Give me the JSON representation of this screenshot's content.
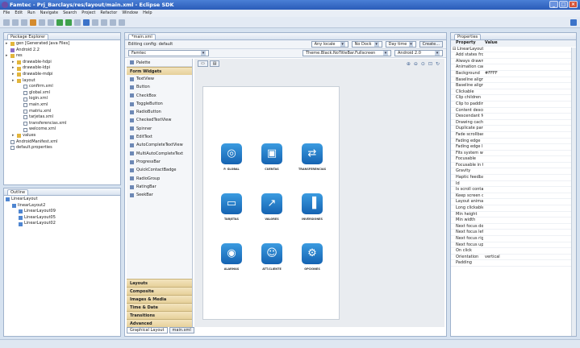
{
  "window": {
    "title": "Famtec - Prj_Barclays/res/layout/main.xml - Eclipse SDK"
  },
  "menu": [
    "File",
    "Edit",
    "Run",
    "Navigate",
    "Search",
    "Project",
    "Refactor",
    "Window",
    "Help"
  ],
  "package_explorer": {
    "tab_label": "Package Explorer",
    "items": [
      {
        "label": "gen [Generated Java Files]",
        "depth": 0,
        "icon": "folder-icon"
      },
      {
        "label": "Android 2.2",
        "depth": 0,
        "icon": "library-icon"
      },
      {
        "label": "res",
        "depth": 0,
        "icon": "folder-icon"
      },
      {
        "label": "drawable-hdpi",
        "depth": 1,
        "icon": "folder-icon"
      },
      {
        "label": "drawable-ldpi",
        "depth": 1,
        "icon": "folder-icon"
      },
      {
        "label": "drawable-mdpi",
        "depth": 1,
        "icon": "folder-icon"
      },
      {
        "label": "layout",
        "depth": 1,
        "icon": "folder-icon"
      },
      {
        "label": "confirm.xml",
        "depth": 2,
        "icon": "file-icon"
      },
      {
        "label": "global.xml",
        "depth": 2,
        "icon": "file-icon"
      },
      {
        "label": "login.xml",
        "depth": 2,
        "icon": "file-icon"
      },
      {
        "label": "main.xml",
        "depth": 2,
        "icon": "file-icon"
      },
      {
        "label": "matriu.xml",
        "depth": 2,
        "icon": "file-icon"
      },
      {
        "label": "tarjetas.xml",
        "depth": 2,
        "icon": "file-icon"
      },
      {
        "label": "transferencias.xml",
        "depth": 2,
        "icon": "file-icon"
      },
      {
        "label": "welcome.xml",
        "depth": 2,
        "icon": "file-icon"
      },
      {
        "label": "values",
        "depth": 1,
        "icon": "folder-icon"
      },
      {
        "label": "AndroidManifest.xml",
        "depth": 0,
        "icon": "file-icon"
      },
      {
        "label": "default.properties",
        "depth": 0,
        "icon": "file-icon"
      }
    ]
  },
  "outline": {
    "tab_label": "Outline",
    "items": [
      {
        "label": "LinearLayout",
        "depth": 0
      },
      {
        "label": "linearLayout2",
        "depth": 1
      },
      {
        "label": "LinearLayout09",
        "depth": 2
      },
      {
        "label": "LinearLayout05",
        "depth": 2
      },
      {
        "label": "LinearLayout02",
        "depth": 2
      }
    ]
  },
  "editor": {
    "tab_label": "*main.xml",
    "editing_config": "Editing config: default",
    "locale": "Any locale",
    "dock": "No Dock",
    "time": "Day time",
    "create_label": "Create...",
    "project": "Famtec",
    "theme": "Theme.Black.NoTitleBar.Fullscreen",
    "target": "Android 2.0",
    "bottom_tabs": [
      "Graphical Layout",
      "main.xml"
    ]
  },
  "palette": {
    "title": "Palette",
    "sections_top": [
      "Form Widgets"
    ],
    "widgets": [
      "TextView",
      "Button",
      "CheckBox",
      "ToggleButton",
      "RadioButton",
      "CheckedTextView",
      "Spinner",
      "EditText",
      "AutoCompleteTextView",
      "MultiAutoCompleteText",
      "ProgressBar",
      "QuickContactBadge",
      "RadioGroup",
      "RatingBar",
      "SeekBar"
    ],
    "sections_bottom": [
      "Layouts",
      "Composite",
      "Images & Media",
      "Time & Date",
      "Transitions",
      "Advanced"
    ]
  },
  "app_icons": [
    {
      "label": "P. GLOBAL",
      "glyph": "◎"
    },
    {
      "label": "CUENTAS",
      "glyph": "▣"
    },
    {
      "label": "TRANSFERENCIAS",
      "glyph": "⇄"
    },
    {
      "label": "TARJETAS",
      "glyph": "▭"
    },
    {
      "label": "VALORES",
      "glyph": "↗"
    },
    {
      "label": "INVERSIONES",
      "glyph": "▐"
    },
    {
      "label": "ALARMAS",
      "glyph": "◉"
    },
    {
      "label": "ATT.CLIENTE",
      "glyph": "☺"
    },
    {
      "label": "OPCIONES",
      "glyph": "⚙"
    }
  ],
  "properties": {
    "tab_label": "Properties",
    "col_property": "Property",
    "col_value": "Value",
    "group": "LinearLayout",
    "rows": [
      {
        "k": "Add states fro",
        "v": ""
      },
      {
        "k": "Always drawn",
        "v": ""
      },
      {
        "k": "Animation cac",
        "v": ""
      },
      {
        "k": "Background",
        "v": "#FFFF"
      },
      {
        "k": "Baseline align",
        "v": ""
      },
      {
        "k": "Baseline align",
        "v": ""
      },
      {
        "k": "Clickable",
        "v": ""
      },
      {
        "k": "Clip children",
        "v": ""
      },
      {
        "k": "Clip to paddin",
        "v": ""
      },
      {
        "k": "Content descr",
        "v": ""
      },
      {
        "k": "Descendant fo",
        "v": ""
      },
      {
        "k": "Drawing cach",
        "v": ""
      },
      {
        "k": "Duplicate pare",
        "v": ""
      },
      {
        "k": "Fade scrollbar",
        "v": ""
      },
      {
        "k": "Fading edge",
        "v": ""
      },
      {
        "k": "Fading edge l",
        "v": ""
      },
      {
        "k": "Fits system w",
        "v": ""
      },
      {
        "k": "Focusable",
        "v": ""
      },
      {
        "k": "Focusable in t",
        "v": ""
      },
      {
        "k": "Gravity",
        "v": ""
      },
      {
        "k": "Haptic feedba",
        "v": ""
      },
      {
        "k": "Id",
        "v": ""
      },
      {
        "k": "Is scroll conta",
        "v": ""
      },
      {
        "k": "Keep screen c",
        "v": ""
      },
      {
        "k": "Layout animat",
        "v": ""
      },
      {
        "k": "Long clickable",
        "v": ""
      },
      {
        "k": "Min height",
        "v": ""
      },
      {
        "k": "Min width",
        "v": ""
      },
      {
        "k": "Next focus do",
        "v": ""
      },
      {
        "k": "Next focus lef",
        "v": ""
      },
      {
        "k": "Next focus rig",
        "v": ""
      },
      {
        "k": "Next focus up",
        "v": ""
      },
      {
        "k": "On click",
        "v": ""
      },
      {
        "k": "Orientation",
        "v": "vertical"
      },
      {
        "k": "Padding",
        "v": ""
      }
    ]
  }
}
